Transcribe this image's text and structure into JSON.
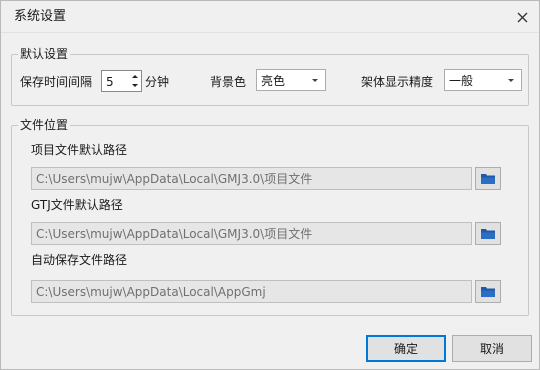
{
  "window": {
    "title": "系统设置"
  },
  "icons": {
    "close": "close-icon",
    "folder": "folder-icon",
    "spin_up": "chevron-up-icon",
    "spin_down": "chevron-down-icon",
    "dropdown": "chevron-down-icon"
  },
  "default_settings": {
    "legend": "默认设置",
    "autosave_label": "保存时间间隔",
    "autosave_value": "5",
    "autosave_unit": "分钟",
    "background_label": "背景色",
    "background_value": "亮色",
    "precision_label": "架体显示精度",
    "precision_value": "一般"
  },
  "file_location": {
    "legend": "文件位置",
    "project_label": "项目文件默认路径",
    "project_path": "C:\\Users\\mujw\\AppData\\Local\\GMJ3.0\\项目文件",
    "gtj_label": "GTJ文件默认路径",
    "gtj_path": "C:\\Users\\mujw\\AppData\\Local\\GMJ3.0\\项目文件",
    "autosave_label": "自动保存文件路径",
    "autosave_path": "C:\\Users\\mujw\\AppData\\Local\\AppGmj"
  },
  "buttons": {
    "ok": "确定",
    "cancel": "取消"
  },
  "colors": {
    "primary_border": "#0078d7",
    "folder": "#1e5aa8"
  }
}
